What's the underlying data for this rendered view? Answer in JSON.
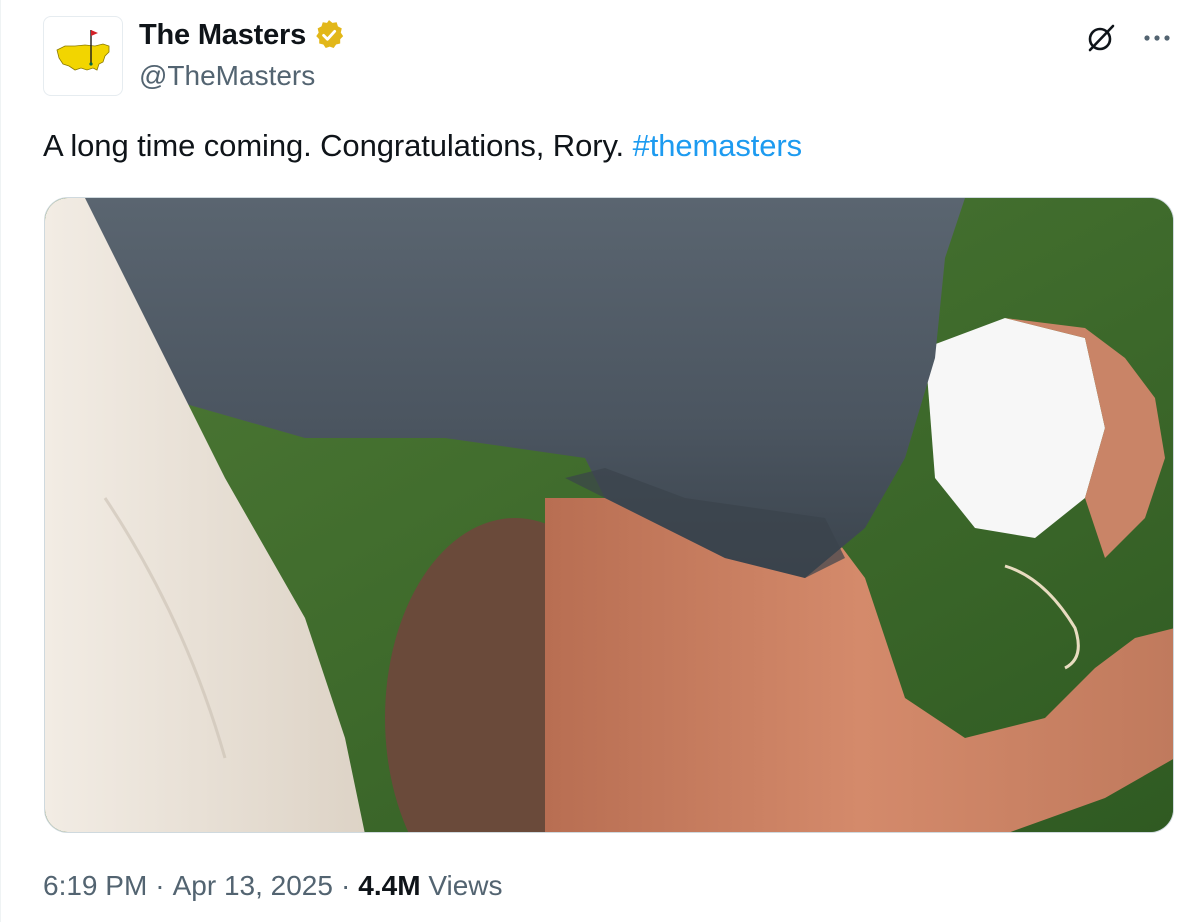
{
  "author": {
    "display_name": "The Masters",
    "handle": "@TheMasters",
    "verified_badge_icon": "verified-gold-badge-icon",
    "avatar_icon": "masters-logo-icon"
  },
  "toolbar": {
    "grok_icon": "grok-icon",
    "more_icon": "more-dots-icon"
  },
  "tweet": {
    "text": "A long time coming. Congratulations, Rory. ",
    "hashtag": "#themasters",
    "hashtag_color": "#1d9bf0"
  },
  "media": {
    "type": "video",
    "description_icon": "video-thumbnail"
  },
  "meta": {
    "time": "6:19 PM",
    "sep1": "·",
    "date": "Apr 13, 2025",
    "sep2": "·",
    "views_count": "4.4M",
    "views_label": "Views"
  },
  "colors": {
    "text_primary": "#0f1419",
    "text_secondary": "#536471",
    "accent": "#1d9bf0",
    "masters_yellow": "#f2d500",
    "masters_green": "#006747",
    "verified_gold": "#e2b719"
  }
}
